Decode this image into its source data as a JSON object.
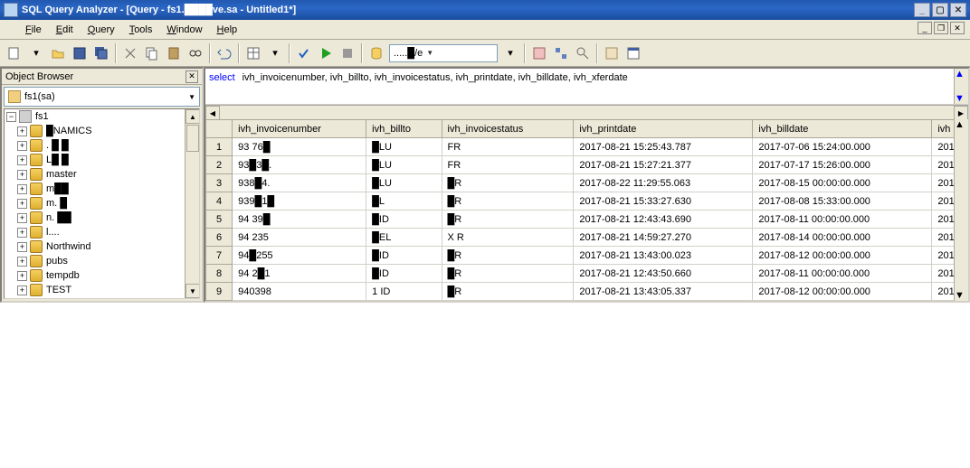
{
  "title": "SQL Query Analyzer - [Query - fs1.████ve.sa - Untitled1*]",
  "menu": {
    "file": "File",
    "edit": "Edit",
    "query": "Query",
    "tools": "Tools",
    "window": "Window",
    "help": "Help"
  },
  "object_browser": {
    "title": "Object Browser",
    "combo": "fs1(sa)",
    "items": [
      {
        "label": "fs1",
        "svr": true
      },
      {
        "label": "█NAMICS"
      },
      {
        "label": ". █ █"
      },
      {
        "label": "L█ █"
      },
      {
        "label": "master"
      },
      {
        "label": "m██"
      },
      {
        "label": "m. █"
      },
      {
        "label": "n. ██"
      },
      {
        "label": "l...."
      },
      {
        "label": "Northwind"
      },
      {
        "label": "pubs"
      },
      {
        "label": "tempdb"
      },
      {
        "label": "TEST"
      }
    ]
  },
  "toolbar": {
    "db_combo": ".....█/e"
  },
  "sql": "select ivh_invoicenumber, ivh_billto, ivh_invoicestatus, ivh_printdate, ivh_billdate, ivh_xferdate",
  "grid": {
    "columns": [
      "ivh_invoicenumber",
      "ivh_billto",
      "ivh_invoicestatus",
      "ivh_printdate",
      "ivh_billdate",
      "ivh"
    ],
    "rows": [
      [
        "93 76█",
        "█LU",
        "FR",
        "2017-08-21 15:25:43.787",
        "2017-07-06 15:24:00.000",
        "201"
      ],
      [
        "93█3█.",
        "█LU",
        "FR",
        "2017-08-21 15:27:21.377",
        "2017-07-17 15:26:00.000",
        "201"
      ],
      [
        "938█4.",
        "█LU",
        "█R",
        "2017-08-22 11:29:55.063",
        "2017-08-15 00:00:00.000",
        "201"
      ],
      [
        "939█1█",
        "█L",
        "█R",
        "2017-08-21 15:33:27.630",
        "2017-08-08 15:33:00.000",
        "201"
      ],
      [
        "94 39█",
        "█ID",
        "█R",
        "2017-08-21 12:43:43.690",
        "2017-08-11 00:00:00.000",
        "201"
      ],
      [
        "94 235",
        "█EL",
        "X R",
        "2017-08-21 14:59:27.270",
        "2017-08-14 00:00:00.000",
        "201"
      ],
      [
        "94█255",
        "█ID",
        "█R",
        "2017-08-21 13:43:00.023",
        "2017-08-12 00:00:00.000",
        "201"
      ],
      [
        "94 2█1",
        "█ID",
        "█R",
        "2017-08-21 12:43:50.660",
        "2017-08-11 00:00:00.000",
        "201"
      ],
      [
        "940398",
        "1 ID",
        "█R",
        "2017-08-21 13:43:05.337",
        "2017-08-12 00:00:00.000",
        "201"
      ]
    ]
  }
}
